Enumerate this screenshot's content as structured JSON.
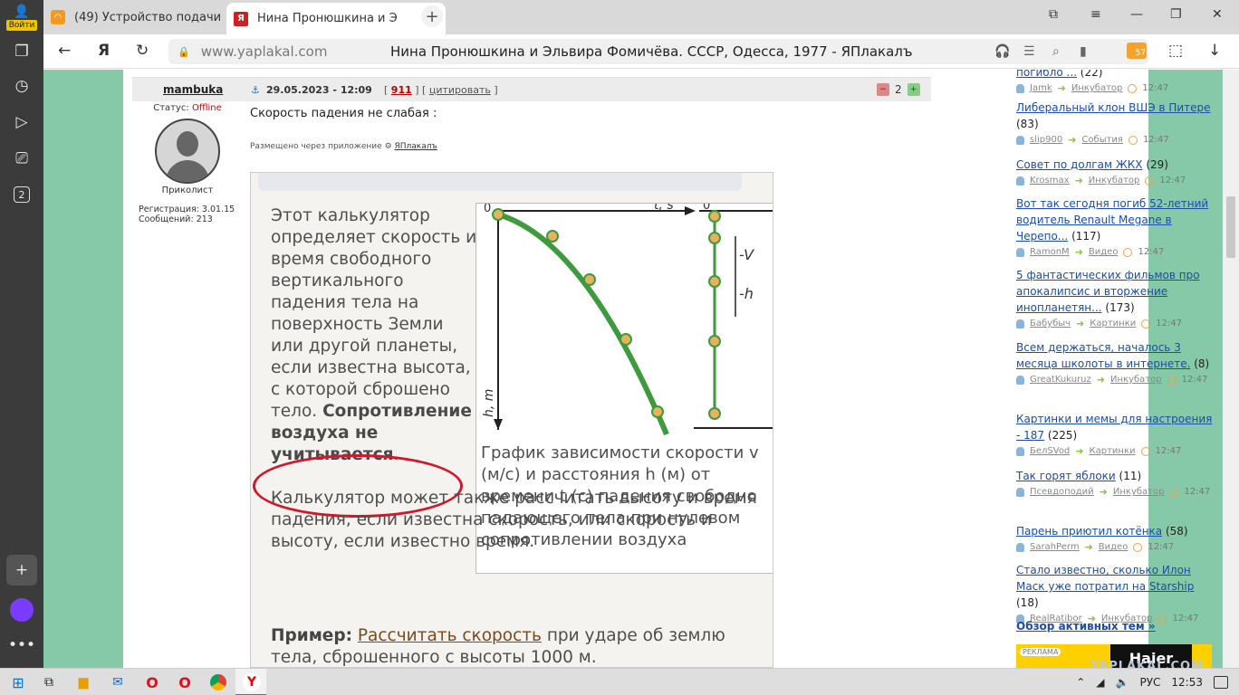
{
  "sidebar": {
    "login_label": "Войти",
    "tab_count": "2"
  },
  "tabs": [
    {
      "label": "(49) Устройство подачи"
    },
    {
      "label": "Нина Пронюшкина и Э"
    }
  ],
  "address": {
    "url": "www.yaplakal.com",
    "title": "Нина Пронюшкина и Эльвира Фомичёва. СССР, Одесса, 1977 - ЯПлакалъ",
    "ext_badge": "57"
  },
  "post": {
    "author": "mambuka",
    "date": "29.05.2023 - 12:09",
    "num": "911",
    "cite": "цитировать",
    "rating": "2",
    "status_label": "Статус:",
    "status_value": "Offline",
    "rank": "Приколист",
    "reg": "Регистрация: 3.01.15",
    "msgs": "Сообщений: 213",
    "text": "Скорость падения не слабая :",
    "via_label": "Размещено через приложение",
    "via_app": "ЯПлакалъ"
  },
  "image_content": {
    "p1": "Этот калькулятор определяет скорость и время свободного вертикального падения тела на поверхность Земли или другой планеты, если известна высота, с которой сброшено тело.",
    "p1_bold": "Сопротивление воздуха не учитывается",
    "p1_end": ".",
    "p2": "Калькулятор может также рассчитать высоту и время падения, если известна скорость, или скорость и высоту, если известно время.",
    "ex_label": "Пример:",
    "ex_link": "Рассчитать скорость",
    "ex_rest": " при ударе об землю тела, сброшенного с высоты 1000 м.",
    "graph_caption": "График зависимости скорости v (м/с) и расстояния h (м) от времени t (с) падения свободно падающего тела при нулевом сопротивлении воздуха",
    "axis_t": "t, s",
    "axis_h": "h, m",
    "axis_v": "-V",
    "axis_hneg": "-h",
    "zero": "0"
  },
  "right_items": [
    {
      "title": "погибло ...",
      "count": "(22)",
      "user": "Jamk",
      "cat": "Инкубатор",
      "time": "12:47"
    },
    {
      "title": "Либеральный клон ВШЭ в Питере",
      "count": "(83)",
      "user": "slip900",
      "cat": "События",
      "time": "12:47"
    },
    {
      "title": "Совет по долгам ЖКХ",
      "count": "(29)",
      "user": "Krosmax",
      "cat": "Инкубатор",
      "time": "12:47"
    },
    {
      "title": "Вот так сегодня погиб 52-летний водитель Renault Megane в Черепо...",
      "count": "(117)",
      "user": "RamonM",
      "cat": "Видео",
      "time": "12:47"
    },
    {
      "title": "5 фантастических фильмов про апокалипсис и вторжение инопланетян...",
      "count": "(173)",
      "user": "Бабубыч",
      "cat": "Картинки",
      "time": "12:47"
    },
    {
      "title": "Всем держаться, началось 3 месяца школоты в интернете.",
      "count": "(8)",
      "user": "GreatKukuruz",
      "cat": "Инкубатор",
      "time": "12:47"
    },
    {
      "title": "Картинки и мемы для настроения - 187",
      "count": "(225)",
      "user": "БелSVod",
      "cat": "Картинки",
      "time": "12:47"
    },
    {
      "title": "Так горят яблоки",
      "count": "(11)",
      "user": "Псевдоподий",
      "cat": "Инкубатор",
      "time": "12:47"
    },
    {
      "title": "Парень приютил котёнка",
      "count": "(58)",
      "user": "SarahPerm",
      "cat": "Видео",
      "time": "12:47"
    },
    {
      "title": "Стало известно, сколько Илон Маск уже потратил на Starship",
      "count": "(18)",
      "user": "RealRatibor",
      "cat": "Инкубатор",
      "time": "12:47"
    }
  ],
  "overview": "Обзор активных тем »",
  "ad": {
    "label": "РЕКЛАМА",
    "brand": "Haier"
  },
  "watermark": "YAPLAKAL.COM",
  "taskbar": {
    "lang": "РУС",
    "time": "12:53"
  }
}
